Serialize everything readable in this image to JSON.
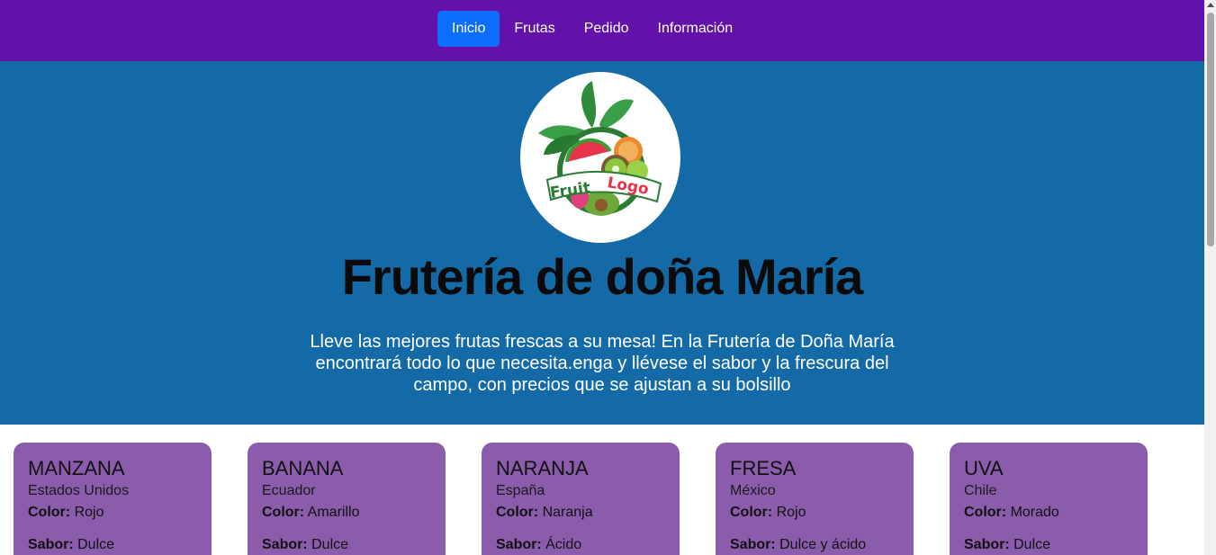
{
  "nav": {
    "items": [
      {
        "label": "Inicio",
        "active": true
      },
      {
        "label": "Frutas",
        "active": false
      },
      {
        "label": "Pedido",
        "active": false
      },
      {
        "label": "Información",
        "active": false
      }
    ]
  },
  "hero": {
    "logo_text": "Fruit Logo",
    "title": "Frutería de doña María",
    "description": "Lleve las mejores frutas frescas a su mesa! En la Frutería de Doña María encontrará todo lo que necesita.enga y llévese el sabor y la frescura del campo, con precios que se ajustan a su bolsillo"
  },
  "cards": [
    {
      "name": "MANZANA",
      "origin": "Estados Unidos",
      "color_label": "Color:",
      "color": "Rojo",
      "sabor_label": "Sabor:",
      "sabor": "Dulce"
    },
    {
      "name": "BANANA",
      "origin": "Ecuador",
      "color_label": "Color:",
      "color": "Amarillo",
      "sabor_label": "Sabor:",
      "sabor": "Dulce"
    },
    {
      "name": "NARANJA",
      "origin": "España",
      "color_label": "Color:",
      "color": "Naranja",
      "sabor_label": "Sabor:",
      "sabor": "Ácido"
    },
    {
      "name": "FRESA",
      "origin": "México",
      "color_label": "Color:",
      "color": "Rojo",
      "sabor_label": "Sabor:",
      "sabor": "Dulce y ácido"
    },
    {
      "name": "UVA",
      "origin": "Chile",
      "color_label": "Color:",
      "color": "Morado",
      "sabor_label": "Sabor:",
      "sabor": "Dulce"
    }
  ],
  "colors": {
    "nav_bg": "#6212a9",
    "nav_active": "#0d6efd",
    "hero_bg": "#146aa6",
    "card_bg": "#8b5bac"
  }
}
